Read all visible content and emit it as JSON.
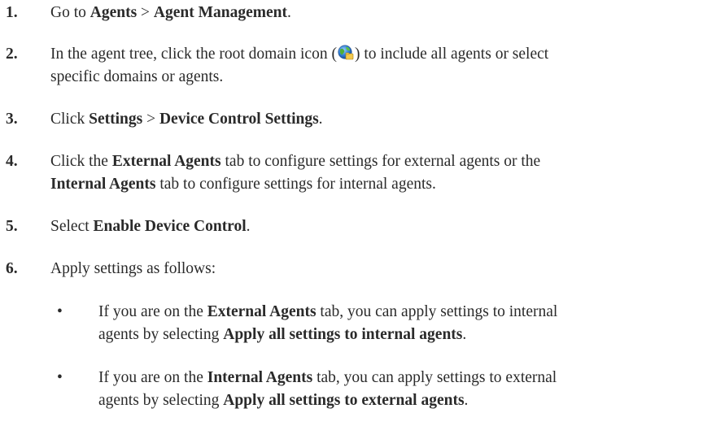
{
  "steps": [
    {
      "number": "1.",
      "parts": [
        {
          "t": "Go to "
        },
        {
          "t": "Agents",
          "b": true
        },
        {
          "t": " > "
        },
        {
          "t": "Agent Management",
          "b": true
        },
        {
          "t": "."
        }
      ]
    },
    {
      "number": "2.",
      "parts_before_icon": [
        {
          "t": "In the agent tree, click the root domain icon ("
        }
      ],
      "icon": "root-domain-globe-icon",
      "parts_after_icon": [
        {
          "t": ") to include all agents or select"
        }
      ],
      "line2": "specific domains or agents."
    },
    {
      "number": "3.",
      "parts": [
        {
          "t": "Click "
        },
        {
          "t": "Settings",
          "b": true
        },
        {
          "t": " > "
        },
        {
          "t": "Device Control Settings",
          "b": true
        },
        {
          "t": "."
        }
      ]
    },
    {
      "number": "4.",
      "line1": [
        {
          "t": "Click the "
        },
        {
          "t": "External Agents",
          "b": true
        },
        {
          "t": " tab to configure settings for external agents or the"
        }
      ],
      "line2": [
        {
          "t": "Internal Agents",
          "b": true
        },
        {
          "t": " tab to configure settings for internal agents."
        }
      ]
    },
    {
      "number": "5.",
      "parts": [
        {
          "t": "Select "
        },
        {
          "t": "Enable Device Control",
          "b": true
        },
        {
          "t": "."
        }
      ]
    },
    {
      "number": "6.",
      "parts": [
        {
          "t": "Apply settings as follows:"
        }
      ]
    }
  ],
  "bullets": [
    {
      "symbol": "•",
      "line1": [
        {
          "t": "If you are on the "
        },
        {
          "t": "External Agents",
          "b": true
        },
        {
          "t": " tab, you can apply settings to internal"
        }
      ],
      "line2": [
        {
          "t": "agents by selecting "
        },
        {
          "t": "Apply all settings to internal agents",
          "b": true
        },
        {
          "t": "."
        }
      ]
    },
    {
      "symbol": "•",
      "line1": [
        {
          "t": "If you are on the "
        },
        {
          "t": "Internal Agents",
          "b": true
        },
        {
          "t": " tab, you can apply settings to external"
        }
      ],
      "line2": [
        {
          "t": "agents by selecting "
        },
        {
          "t": "Apply all settings to external agents",
          "b": true
        },
        {
          "t": "."
        }
      ]
    }
  ]
}
